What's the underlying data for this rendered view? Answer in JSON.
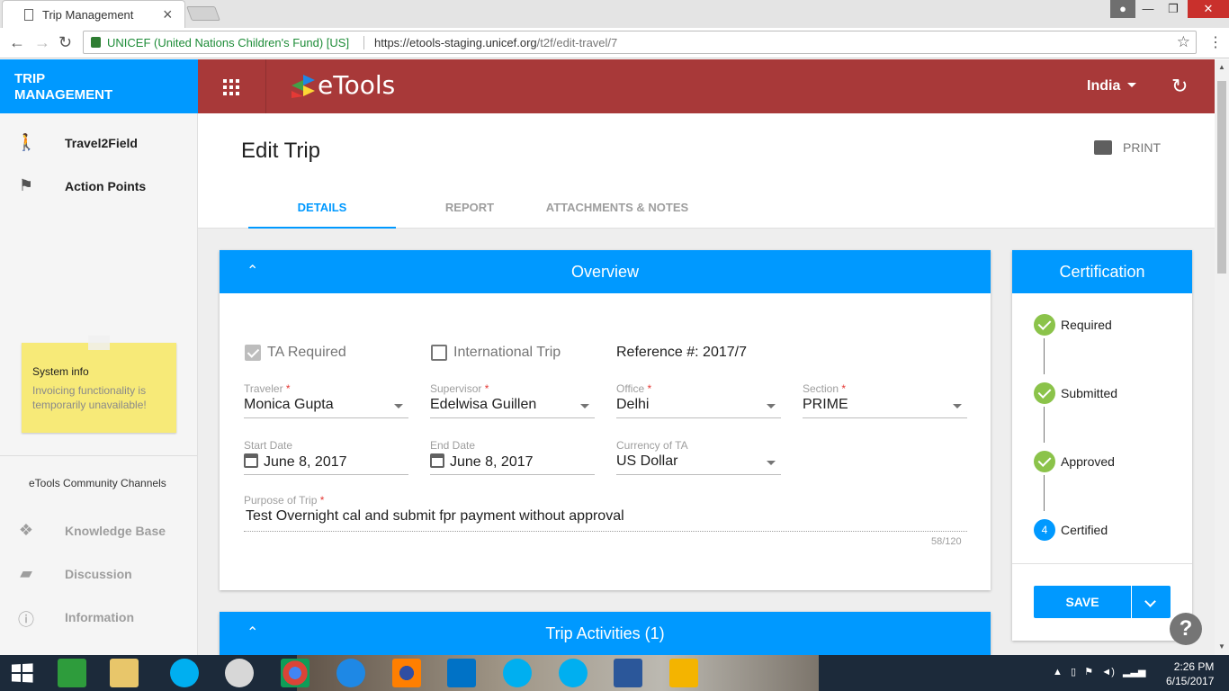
{
  "browser": {
    "tab_title": "Trip Management",
    "tab_close": "×",
    "secure_label": "UNICEF (United Nations Children's Fund) [US]",
    "url_host": "https://etools-staging.unicef.org",
    "url_path": "/t2f/edit-travel/7"
  },
  "sidebar": {
    "title_line1": "TRIP",
    "title_line2": "MANAGEMENT",
    "items": [
      {
        "label": "Travel2Field",
        "icon": "walk-icon"
      },
      {
        "label": "Action Points",
        "icon": "flag-icon"
      }
    ],
    "sysinfo": {
      "title": "System info",
      "message": "Invoicing functionality is temporarily unavailable!"
    },
    "community_title": "eTools Community Channels",
    "community": [
      {
        "label": "Knowledge Base",
        "icon": "book-icon"
      },
      {
        "label": "Discussion",
        "icon": "forum-icon"
      },
      {
        "label": "Information",
        "icon": "info-icon"
      }
    ]
  },
  "appbar": {
    "logo": "eTools",
    "country": "India"
  },
  "page": {
    "title": "Edit Trip",
    "print_label": "PRINT",
    "tabs": [
      "DETAILS",
      "REPORT",
      "ATTACHMENTS & NOTES"
    ],
    "active_tab": 0
  },
  "overview": {
    "title": "Overview",
    "ta_required_label": "TA Required",
    "ta_required": true,
    "international_label": "International Trip",
    "international": false,
    "reference": "Reference #: 2017/7",
    "traveler_label": "Traveler",
    "traveler": "Monica Gupta",
    "supervisor_label": "Supervisor",
    "supervisor": "Edelwisa Guillen",
    "office_label": "Office",
    "office": "Delhi",
    "section_label": "Section",
    "section": "PRIME",
    "start_label": "Start Date",
    "start": "June 8, 2017",
    "end_label": "End Date",
    "end": "June 8, 2017",
    "currency_label": "Currency of TA",
    "currency": "US Dollar",
    "purpose_label": "Purpose of Trip",
    "purpose": "Test Overnight cal and submit fpr payment without approval",
    "purpose_counter": "58/120",
    "required_mark": "*"
  },
  "activities": {
    "title": "Trip Activities (1)"
  },
  "certification": {
    "title": "Certification",
    "steps": [
      {
        "label": "Required",
        "done": true
      },
      {
        "label": "Submitted",
        "done": true
      },
      {
        "label": "Approved",
        "done": true
      },
      {
        "label": "Certified",
        "done": false,
        "number": "4"
      }
    ],
    "save_label": "SAVE"
  },
  "help_label": "?",
  "taskbar": {
    "time": "2:26 PM",
    "date": "6/15/2017"
  },
  "colors": {
    "primary": "#0099ff",
    "appbar": "#a83939",
    "success": "#8bc34a",
    "note": "#f7ea78"
  }
}
